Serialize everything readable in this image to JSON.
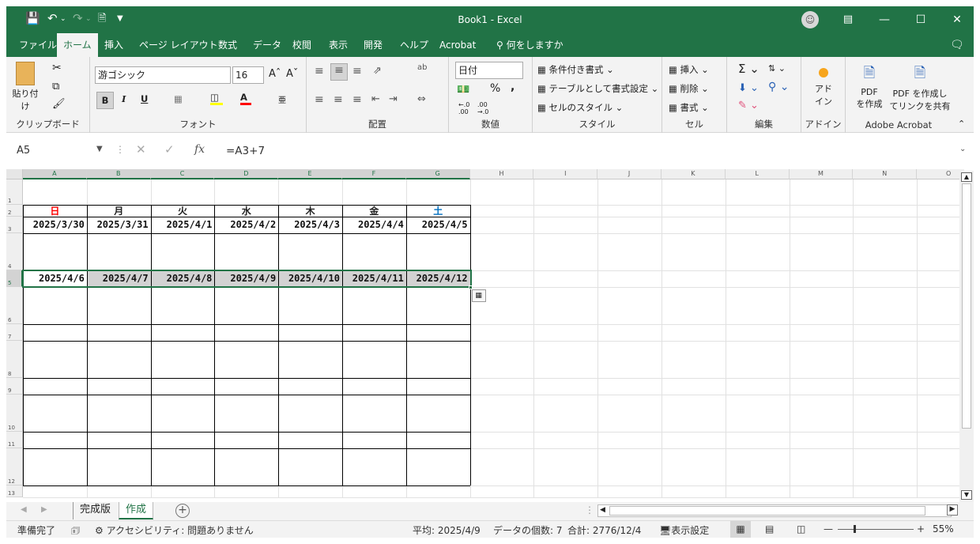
{
  "title": {
    "doc": "Book1  -  Excel"
  },
  "tabs": [
    "ファイル",
    "ホーム",
    "挿入",
    "ページ レイアウト",
    "数式",
    "データ",
    "校閲",
    "表示",
    "開発",
    "ヘルプ",
    "Acrobat",
    "何をしますか"
  ],
  "ribbon": {
    "clipboard": {
      "paste": "貼り付け",
      "label": "クリップボード"
    },
    "font": {
      "name": "游ゴシック",
      "size": "16",
      "label": "フォント"
    },
    "alignment": {
      "label": "配置"
    },
    "number": {
      "format": "日付",
      "label": "数値"
    },
    "styles": {
      "cond": "条件付き書式",
      "table": "テーブルとして書式設定",
      "cell": "セルのスタイル",
      "label": "スタイル"
    },
    "cells": {
      "insert": "挿入",
      "delete": "削除",
      "format": "書式",
      "label": "セル"
    },
    "editing": {
      "label": "編集"
    },
    "addins": {
      "name1": "アド",
      "name2": "イン",
      "label": "アドイン"
    },
    "acrobat": {
      "b1a": "PDF",
      "b1b": "を作成",
      "b2a": "PDF を作成し",
      "b2b": "てリンクを共有",
      "label": "Adobe Acrobat"
    }
  },
  "formula": {
    "namebox": "A5",
    "fx": "fx",
    "text": "=A3+7"
  },
  "columns": [
    "A",
    "B",
    "C",
    "D",
    "E",
    "F",
    "G",
    "H",
    "I",
    "J",
    "K",
    "L",
    "M",
    "N",
    "O"
  ],
  "rows": [
    "1",
    "2",
    "3",
    "4",
    "5",
    "6",
    "7",
    "8",
    "9",
    "10",
    "11",
    "12",
    "13"
  ],
  "weekdays": [
    "日",
    "月",
    "火",
    "水",
    "木",
    "金",
    "土"
  ],
  "weekday_colors": {
    "sun": "#ff0000",
    "sat": "#0070c0"
  },
  "week1": [
    "2025/3/30",
    "2025/3/31",
    "2025/4/1",
    "2025/4/2",
    "2025/4/3",
    "2025/4/4",
    "2025/4/5"
  ],
  "week2": [
    "2025/4/6",
    "2025/4/7",
    "2025/4/8",
    "2025/4/9",
    "2025/4/10",
    "2025/4/11",
    "2025/4/12"
  ],
  "sheets": {
    "s1": "完成版",
    "s2": "作成"
  },
  "status": {
    "ready": "準備完了",
    "access": "アクセシビリティ: 問題ありません",
    "avg": "平均: 2025/4/9",
    "count": "データの個数: 7",
    "sum": "合計: 2776/12/4",
    "display": "表示設定",
    "zoom": "55%"
  },
  "colors": {
    "accent": "#217346"
  }
}
